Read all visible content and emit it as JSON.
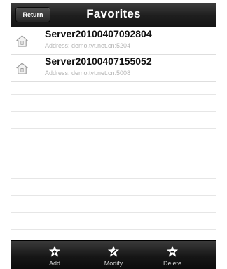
{
  "navbar": {
    "back_label": "Return",
    "title": "Favorites"
  },
  "favorites": {
    "items": [
      {
        "name": "Server20100407092804",
        "address": "Address: demo.tvt.net.cn:5204",
        "icon": "home-icon"
      },
      {
        "name": "Server20100407155052",
        "address": "Address: demo.tvt.net.cn:5008",
        "icon": "home-icon"
      }
    ]
  },
  "toolbar": {
    "add_label": "Add",
    "modify_label": "Modify",
    "delete_label": "Delete",
    "add_icon": "star-plus-icon",
    "modify_icon": "star-pencil-icon",
    "delete_icon": "star-minus-icon"
  },
  "colors": {
    "bar_dark": "#1e1e1e",
    "title_text": "#ffffff",
    "address_text": "#b5b5b5"
  }
}
